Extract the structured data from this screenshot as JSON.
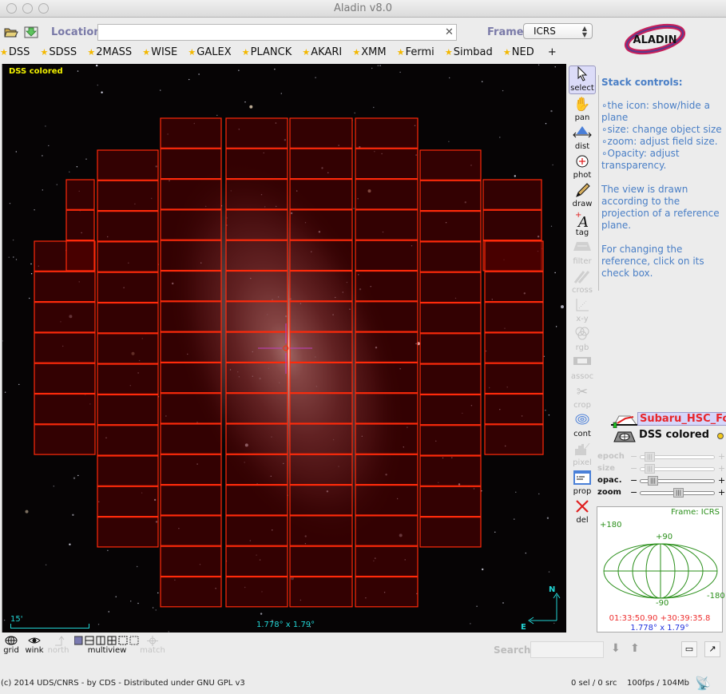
{
  "window": {
    "title": "Aladin v8.0"
  },
  "toolbar": {
    "open_icon": "folder-open-icon",
    "load_icon": "download-icon",
    "location_label": "Location",
    "location_value": "",
    "location_placeholder": "",
    "clear_glyph": "✕",
    "frame_label": "Frame",
    "frame_value": "ICRS",
    "logo_text": "ALADIN"
  },
  "surveys": [
    {
      "label": "DSS"
    },
    {
      "label": "SDSS"
    },
    {
      "label": "2MASS"
    },
    {
      "label": "WISE"
    },
    {
      "label": "GALEX"
    },
    {
      "label": "PLANCK"
    },
    {
      "label": "AKARI"
    },
    {
      "label": "XMM"
    },
    {
      "label": "Fermi"
    },
    {
      "label": "Simbad"
    },
    {
      "label": "NED"
    }
  ],
  "surveys_add": "+",
  "view": {
    "plane_label": "DSS colored",
    "scale_label": "15'",
    "fov_label": "1.778° x 1.79°",
    "compass_north": "N",
    "compass_east": "E",
    "overlay_color": "#ff2a0a",
    "reticle_color": "#c040c0"
  },
  "tools": [
    {
      "id": "select",
      "label": "select",
      "icon": "cursor-arrow-icon",
      "state": "active"
    },
    {
      "id": "pan",
      "label": "pan",
      "icon": "hand-icon",
      "state": "enabled"
    },
    {
      "id": "dist",
      "label": "dist",
      "icon": "distance-icon",
      "state": "enabled"
    },
    {
      "id": "phot",
      "label": "phot",
      "icon": "photometry-icon",
      "state": "enabled"
    },
    {
      "id": "draw",
      "label": "draw",
      "icon": "pencil-icon",
      "state": "enabled"
    },
    {
      "id": "tag",
      "label": "tag",
      "icon": "text-tag-icon",
      "state": "enabled"
    },
    {
      "id": "filter",
      "label": "filter",
      "icon": "filter-icon",
      "state": "disabled"
    },
    {
      "id": "cross",
      "label": "cross",
      "icon": "cross-match-icon",
      "state": "disabled"
    },
    {
      "id": "xy",
      "label": "x-y",
      "icon": "scatter-plot-icon",
      "state": "disabled"
    },
    {
      "id": "rgb",
      "label": "rgb",
      "icon": "rgb-circles-icon",
      "state": "disabled"
    },
    {
      "id": "assoc",
      "label": "assoc",
      "icon": "film-strip-icon",
      "state": "disabled"
    },
    {
      "id": "crop",
      "label": "crop",
      "icon": "scissors-icon",
      "state": "disabled"
    },
    {
      "id": "cont",
      "label": "cont",
      "icon": "contour-icon",
      "state": "enabled"
    },
    {
      "id": "pixel",
      "label": "pixel",
      "icon": "histogram-icon",
      "state": "disabled"
    },
    {
      "id": "prop",
      "label": "prop",
      "icon": "properties-window-icon",
      "state": "enabled"
    },
    {
      "id": "del",
      "label": "del",
      "icon": "delete-x-icon",
      "state": "enabled"
    }
  ],
  "help": {
    "heading": "Stack controls:",
    "bullets": [
      "the icon: show/hide a plane",
      "size: change object size",
      "zoom: adjust field size.",
      "Opacity: adjust transparency."
    ],
    "para1": "The view is drawn according to the projection of a reference plane.",
    "para2": "For changing the reference, click on its check box."
  },
  "stack": {
    "layers": [
      {
        "name": "Subaru_HSC_FoV",
        "type": "overlay",
        "selected": true
      },
      {
        "name": "DSS colored",
        "type": "image",
        "selected": false
      }
    ]
  },
  "sliders": [
    {
      "label": "epoch",
      "enabled": false,
      "value": 0.05
    },
    {
      "label": "size",
      "enabled": false,
      "value": 0.05
    },
    {
      "label": "opac.",
      "enabled": true,
      "value": 0.1
    },
    {
      "label": "zoom",
      "enabled": true,
      "value": 0.5
    }
  ],
  "projection": {
    "frame": "Frame: ICRS",
    "tick_top": "+90",
    "tick_bottom": "-90",
    "tick_left": "+180",
    "tick_right": "-180",
    "coordinates": "01:33:50.90 +30:39:35.8",
    "fov": "1.778° x 1.79°"
  },
  "bottom_tools": [
    {
      "label": "grid",
      "icon": "globe-grid-icon",
      "state": "enabled"
    },
    {
      "label": "wink",
      "icon": "eye-icon",
      "state": "enabled"
    },
    {
      "label": "north",
      "icon": "north-arrow-icon",
      "state": "disabled"
    },
    {
      "label": "multiview",
      "icon": "multiview-icon",
      "state": "enabled"
    },
    {
      "label": "match",
      "icon": "crosshair-icon",
      "state": "disabled"
    }
  ],
  "search": {
    "label": "Search",
    "value": ""
  },
  "status": {
    "copyright": "(c) 2014 UDS/CNRS - by CDS - Distributed under GNU GPL v3",
    "selection": "0 sel / 0 src",
    "performance": "100fps / 104Mb"
  }
}
